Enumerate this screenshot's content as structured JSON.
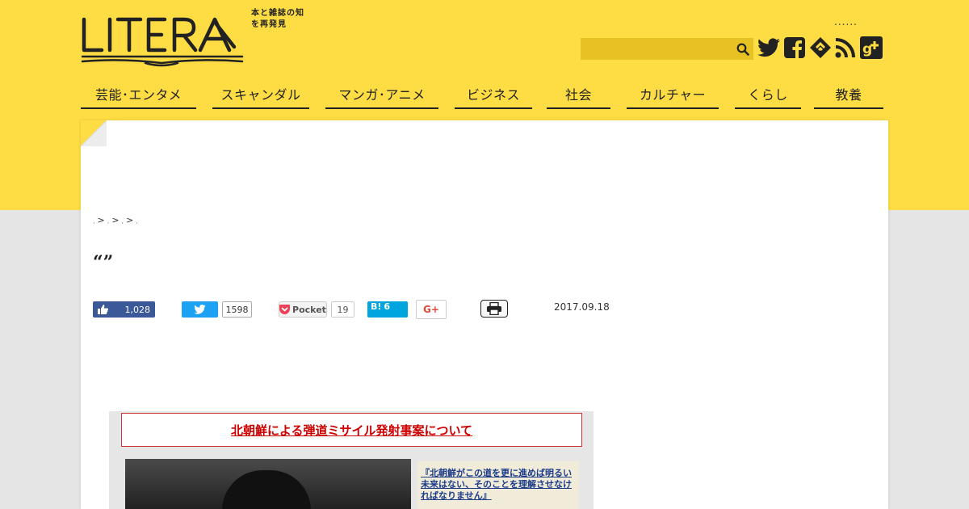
{
  "header": {
    "brand": "LITERA",
    "tagline": "本と雑誌の知を再発見",
    "dots": "......",
    "search": {
      "placeholder": "",
      "value": ""
    },
    "social_icons": [
      "twitter-icon",
      "facebook-icon",
      "feedly-icon",
      "rss-icon",
      "google-plus-icon"
    ]
  },
  "nav": {
    "items": [
      {
        "label": "芸能･エンタメ"
      },
      {
        "label": "スキャンダル"
      },
      {
        "label": "マンガ･アニメ"
      },
      {
        "label": "ビジネス"
      },
      {
        "label": "社会"
      },
      {
        "label": "カルチャー"
      },
      {
        "label": "くらし"
      },
      {
        "label": "教養"
      }
    ]
  },
  "breadcrumbs": {
    "items": [
      ",",
      ",",
      ",",
      ","
    ],
    "separator": ">"
  },
  "article": {
    "title": "“”",
    "date": "2017.09.18",
    "image": {
      "heading": "北朝鮮による弾道ミサイル発射事案について",
      "quote": "『北朝鮮がこの道を更に進めば明るい未来はない、そのことを理解させなければなりません』"
    }
  },
  "share": {
    "facebook_count": "1,028",
    "twitter_count": "1598",
    "pocket_label": "Pocket",
    "pocket_count": "19",
    "hatena_label": "B!",
    "hatena_count": "6",
    "gplus_label": "G+"
  },
  "colors": {
    "header_yellow": "#fedd44",
    "search_bg": "#e6c322",
    "facebook": "#3b5998",
    "twitter": "#1da1f2",
    "hatena": "#00a4de",
    "gplus": "#dd4b39"
  }
}
